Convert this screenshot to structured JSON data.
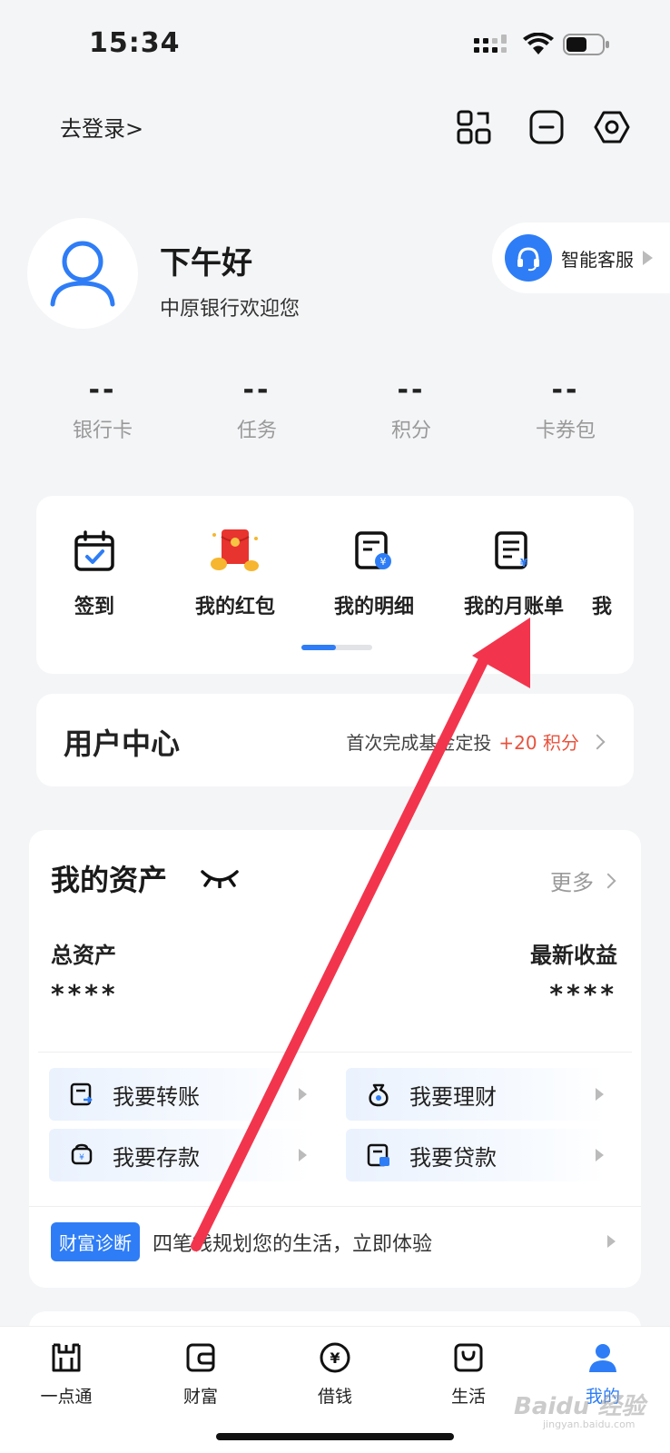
{
  "status_bar": {
    "time": "15:34"
  },
  "header": {
    "login_text": "去登录>"
  },
  "profile": {
    "greeting": "下午好",
    "welcome": "中原银行欢迎您",
    "service_label": "智能客服"
  },
  "stats": [
    {
      "value": "--",
      "label": "银行卡"
    },
    {
      "value": "--",
      "label": "任务"
    },
    {
      "value": "--",
      "label": "积分"
    },
    {
      "value": "--",
      "label": "卡券包"
    }
  ],
  "quick_menu": {
    "items": [
      {
        "label": "签到"
      },
      {
        "label": "我的红包"
      },
      {
        "label": "我的明细"
      },
      {
        "label": "我的月账单"
      },
      {
        "label": "我"
      }
    ]
  },
  "user_center": {
    "title": "用户中心",
    "promo_text": "首次完成基金定投",
    "promo_points": "+20 积分"
  },
  "assets": {
    "title": "我的资产",
    "more": "更多",
    "total_label": "总资产",
    "total_value": "****",
    "earn_label": "最新收益",
    "earn_value": "****",
    "actions": [
      {
        "label": "我要转账"
      },
      {
        "label": "我要理财"
      },
      {
        "label": "我要存款"
      },
      {
        "label": "我要贷款"
      }
    ],
    "diag_badge": "财富诊断",
    "diag_text": "四笔钱规划您的生活，立即体验"
  },
  "tabbar": {
    "items": [
      {
        "label": "一点通"
      },
      {
        "label": "财富"
      },
      {
        "label": "借钱"
      },
      {
        "label": "生活"
      },
      {
        "label": "我的"
      }
    ]
  },
  "watermark": {
    "text": "Baidu 经验",
    "sub": "jingyan.baidu.com"
  },
  "colors": {
    "accent": "#2e7df6",
    "points": "#e8523c",
    "annotation_arrow": "#f2354d"
  }
}
